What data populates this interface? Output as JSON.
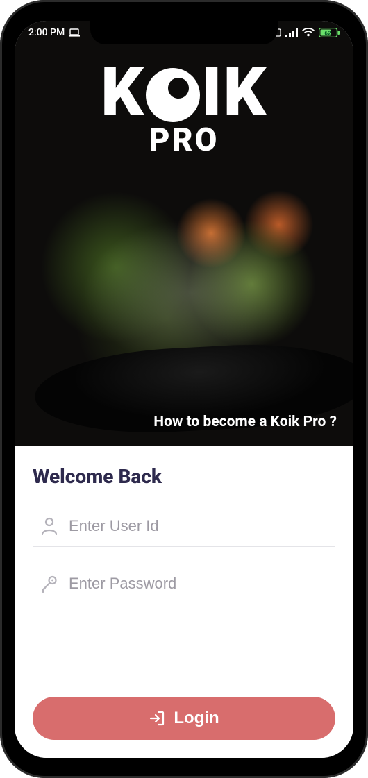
{
  "status_bar": {
    "time": "2:00 PM",
    "battery_pct": "62"
  },
  "hero": {
    "brand_main_left": "K",
    "brand_main_right": "IK",
    "brand_sub": "PRO",
    "link_text": "How to become a Koik Pro ?"
  },
  "form": {
    "welcome": "Welcome Back",
    "user_placeholder": "Enter User Id",
    "password_placeholder": "Enter Password",
    "login_label": "Login"
  },
  "colors": {
    "accent": "#d86d6d",
    "heading": "#2e2a4d"
  }
}
